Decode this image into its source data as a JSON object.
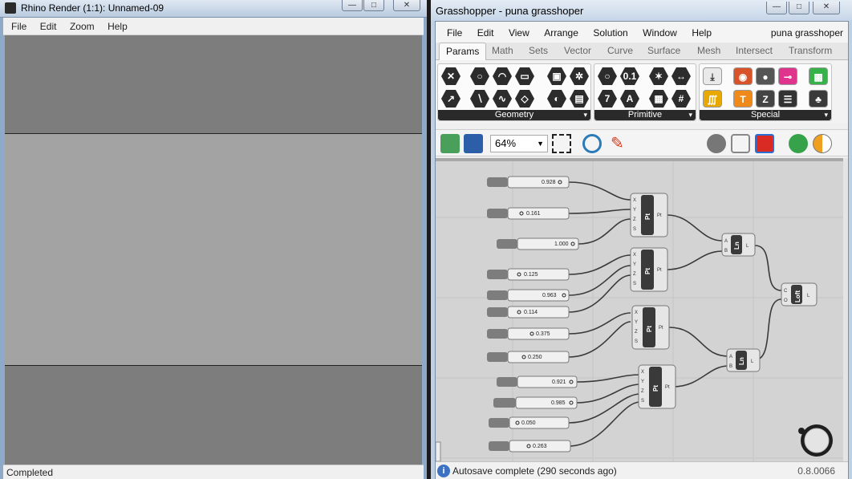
{
  "rhino": {
    "title": "Rhino Render (1:1): Unnamed-09",
    "menu": [
      "File",
      "Edit",
      "Zoom",
      "Help"
    ],
    "status": "Completed"
  },
  "grasshopper": {
    "title": "Grasshopper - puna grasshoper",
    "menu": [
      "File",
      "Edit",
      "View",
      "Arrange",
      "Solution",
      "Window",
      "Help"
    ],
    "document_name": "puna grasshoper",
    "tabs": [
      "Params",
      "Math",
      "Sets",
      "Vector",
      "Curve",
      "Surface",
      "Mesh",
      "Intersect",
      "Transform"
    ],
    "active_tab": "Params",
    "ribbon_groups": [
      "Geometry",
      "Primitive",
      "Special"
    ],
    "zoom": "64%",
    "status": "Autosave complete (290 seconds ago)",
    "version": "0.8.0066"
  },
  "sliders": [
    "0.928",
    "0.161",
    "1.000",
    "0.125",
    "0.963",
    "0.114",
    "0.375",
    "0.250",
    "0.921",
    "0.985",
    "0.050",
    "0.263"
  ],
  "components": {
    "point_name": "Pt",
    "point_inputs": [
      "X",
      "Y",
      "Z",
      "S"
    ],
    "point_output": "Pt",
    "line_name": "Ln",
    "line_inputs": [
      "A",
      "B"
    ],
    "line_output": "L",
    "loft_name": "Loft",
    "loft_inputs": [
      "C",
      "O"
    ],
    "loft_output": "L"
  }
}
